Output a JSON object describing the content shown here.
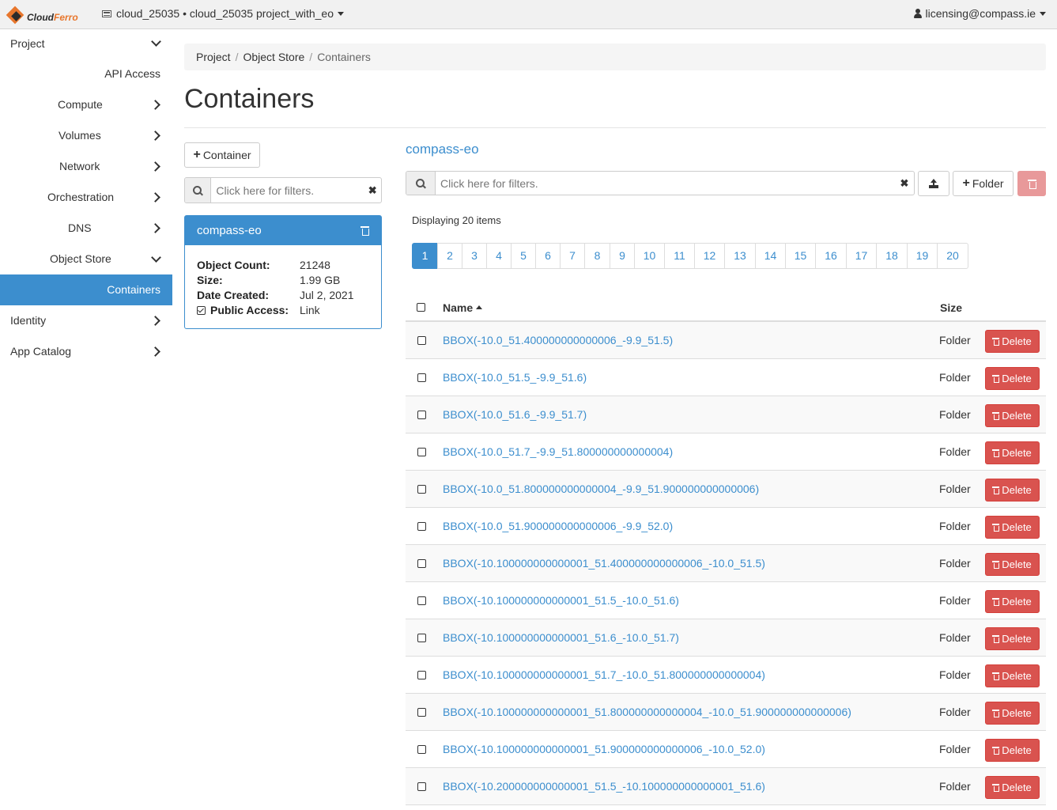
{
  "topbar": {
    "logo_text_a": "Cloud",
    "logo_text_b": "Ferro",
    "project_switch": "cloud_25035 • cloud_25035 project_with_eo",
    "user": "licensing@compass.ie"
  },
  "sidebar": {
    "project": "Project",
    "api_access": "API Access",
    "compute": "Compute",
    "volumes": "Volumes",
    "network": "Network",
    "orchestration": "Orchestration",
    "dns": "DNS",
    "object_store": "Object Store",
    "containers": "Containers",
    "identity": "Identity",
    "app_catalog": "App Catalog"
  },
  "breadcrumb": [
    "Project",
    "Object Store",
    "Containers"
  ],
  "page_title": "Containers",
  "left": {
    "add_container_label": "Container",
    "filter_placeholder": "Click here for filters.",
    "card": {
      "name": "compass-eo",
      "object_count_label": "Object Count:",
      "object_count": "21248",
      "size_label": "Size:",
      "size": "1.99 GB",
      "date_created_label": "Date Created:",
      "date_created": "Jul 2, 2021",
      "public_access_label": "Public Access:",
      "public_access": "Link"
    }
  },
  "right": {
    "container_name": "compass-eo",
    "filter_placeholder": "Click here for filters.",
    "folder_label": "Folder",
    "displaying": "Displaying 20 items",
    "pages": [
      "1",
      "2",
      "3",
      "4",
      "5",
      "6",
      "7",
      "8",
      "9",
      "10",
      "11",
      "12",
      "13",
      "14",
      "15",
      "16",
      "17",
      "18",
      "19",
      "20"
    ],
    "active_page": "1",
    "table": {
      "col_name": "Name",
      "col_size": "Size",
      "delete_label": "Delete",
      "rows": [
        {
          "name": "BBOX(-10.0_51.400000000000006_-9.9_51.5)",
          "size": "Folder"
        },
        {
          "name": "BBOX(-10.0_51.5_-9.9_51.6)",
          "size": "Folder"
        },
        {
          "name": "BBOX(-10.0_51.6_-9.9_51.7)",
          "size": "Folder"
        },
        {
          "name": "BBOX(-10.0_51.7_-9.9_51.800000000000004)",
          "size": "Folder"
        },
        {
          "name": "BBOX(-10.0_51.800000000000004_-9.9_51.900000000000006)",
          "size": "Folder"
        },
        {
          "name": "BBOX(-10.0_51.900000000000006_-9.9_52.0)",
          "size": "Folder"
        },
        {
          "name": "BBOX(-10.100000000000001_51.400000000000006_-10.0_51.5)",
          "size": "Folder"
        },
        {
          "name": "BBOX(-10.100000000000001_51.5_-10.0_51.6)",
          "size": "Folder"
        },
        {
          "name": "BBOX(-10.100000000000001_51.6_-10.0_51.7)",
          "size": "Folder"
        },
        {
          "name": "BBOX(-10.100000000000001_51.7_-10.0_51.800000000000004)",
          "size": "Folder"
        },
        {
          "name": "BBOX(-10.100000000000001_51.800000000000004_-10.0_51.900000000000006)",
          "size": "Folder"
        },
        {
          "name": "BBOX(-10.100000000000001_51.900000000000006_-10.0_52.0)",
          "size": "Folder"
        },
        {
          "name": "BBOX(-10.200000000000001_51.5_-10.100000000000001_51.6)",
          "size": "Folder"
        }
      ]
    }
  },
  "colors": {
    "accent": "#3c8ece",
    "danger": "#d9534f",
    "brand_orange": "#e8762c"
  }
}
